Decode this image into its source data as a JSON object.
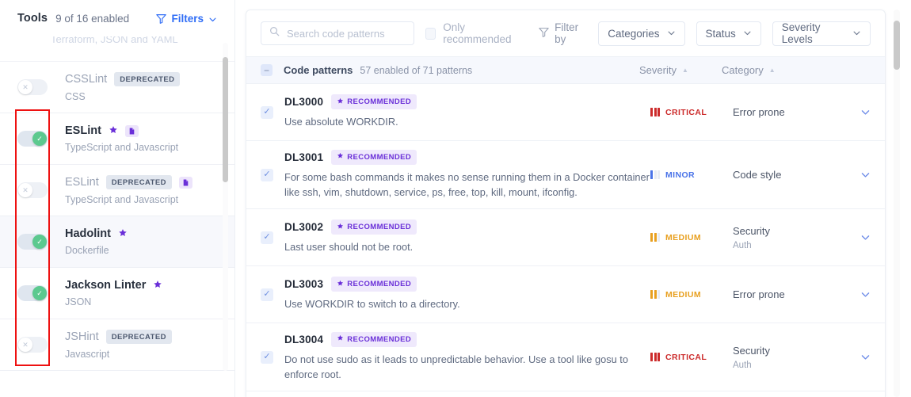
{
  "sidebar": {
    "title": "Tools",
    "count_label": "9 of 16 enabled",
    "filters_label": "Filters",
    "faded_row_text": "Terraform, JSON and YAML",
    "tools": [
      {
        "name": "CSSLint",
        "lang": "CSS",
        "enabled": false,
        "deprecated": true,
        "deprecated_label": "DEPRECATED",
        "star": false,
        "file_icon": false,
        "highlight": false
      },
      {
        "name": "ESLint",
        "lang": "TypeScript and Javascript",
        "enabled": true,
        "deprecated": false,
        "deprecated_label": "",
        "star": true,
        "file_icon": true,
        "highlight": false
      },
      {
        "name": "ESLint",
        "lang": "TypeScript and Javascript",
        "enabled": false,
        "deprecated": true,
        "deprecated_label": "DEPRECATED",
        "star": false,
        "file_icon": true,
        "highlight": false
      },
      {
        "name": "Hadolint",
        "lang": "Dockerfile",
        "enabled": true,
        "deprecated": false,
        "deprecated_label": "",
        "star": true,
        "file_icon": false,
        "highlight": true
      },
      {
        "name": "Jackson Linter",
        "lang": "JSON",
        "enabled": true,
        "deprecated": false,
        "deprecated_label": "",
        "star": true,
        "file_icon": false,
        "highlight": false
      },
      {
        "name": "JSHint",
        "lang": "Javascript",
        "enabled": false,
        "deprecated": true,
        "deprecated_label": "DEPRECATED",
        "star": false,
        "file_icon": false,
        "highlight": false
      }
    ]
  },
  "toolbar": {
    "search_placeholder": "Search code patterns",
    "search_value": "",
    "only_recommended_label": "Only recommended",
    "only_recommended_checked": false,
    "filter_by_label": "Filter by",
    "dropdowns": [
      {
        "label": "Categories"
      },
      {
        "label": "Status"
      },
      {
        "label": "Severity Levels"
      }
    ]
  },
  "table": {
    "header": {
      "title": "Code patterns",
      "subtitle": "57 enabled of 71 patterns",
      "severity_col": "Severity",
      "category_col": "Category"
    },
    "rows": [
      {
        "id": "DL3000",
        "recommended_label": "RECOMMENDED",
        "description": "Use absolute WORKDIR.",
        "severity": "CRITICAL",
        "severity_level": 3,
        "severity_color": "#cc2b2b",
        "category": "Error prone",
        "category_sub": "",
        "checked": true
      },
      {
        "id": "DL3001",
        "recommended_label": "RECOMMENDED",
        "description": "For some bash commands it makes no sense running them in a Docker container like ssh, vim, shutdown, service, ps, free, top, kill, mount, ifconfig.",
        "severity": "MINOR",
        "severity_level": 1,
        "severity_color": "#4a73e8",
        "category": "Code style",
        "category_sub": "",
        "checked": true
      },
      {
        "id": "DL3002",
        "recommended_label": "RECOMMENDED",
        "description": "Last user should not be root.",
        "severity": "MEDIUM",
        "severity_level": 2,
        "severity_color": "#e8a020",
        "category": "Security",
        "category_sub": "Auth",
        "checked": true
      },
      {
        "id": "DL3003",
        "recommended_label": "RECOMMENDED",
        "description": "Use WORKDIR to switch to a directory.",
        "severity": "MEDIUM",
        "severity_level": 2,
        "severity_color": "#e8a020",
        "category": "Error prone",
        "category_sub": "",
        "checked": true
      },
      {
        "id": "DL3004",
        "recommended_label": "RECOMMENDED",
        "description": "Do not use sudo as it leads to unpredictable behavior. Use a tool like gosu to enforce root.",
        "severity": "CRITICAL",
        "severity_level": 3,
        "severity_color": "#cc2b2b",
        "category": "Security",
        "category_sub": "Auth",
        "checked": true
      }
    ]
  },
  "colors": {
    "accent_blue": "#2f6df6",
    "purple": "#6a2fd8",
    "toggle_on": "#5cc98f",
    "annotation_red": "#ee1111"
  }
}
